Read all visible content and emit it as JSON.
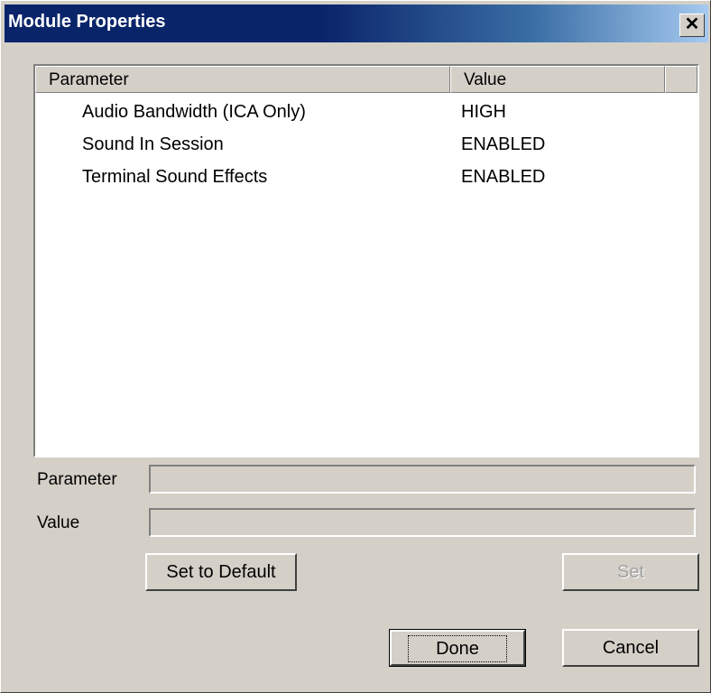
{
  "window": {
    "title": "Module Properties",
    "close_glyph": "✕"
  },
  "list": {
    "columns": [
      "Parameter",
      "Value"
    ],
    "rows": [
      {
        "parameter": "Audio Bandwidth (ICA Only)",
        "value": "HIGH"
      },
      {
        "parameter": "Sound In Session",
        "value": "ENABLED"
      },
      {
        "parameter": "Terminal Sound Effects",
        "value": "ENABLED"
      }
    ]
  },
  "fields": {
    "parameter_label": "Parameter",
    "parameter_value": "",
    "value_label": "Value",
    "value_value": ""
  },
  "buttons": {
    "set_default": "Set to Default",
    "set": "Set",
    "done": "Done",
    "cancel": "Cancel"
  }
}
